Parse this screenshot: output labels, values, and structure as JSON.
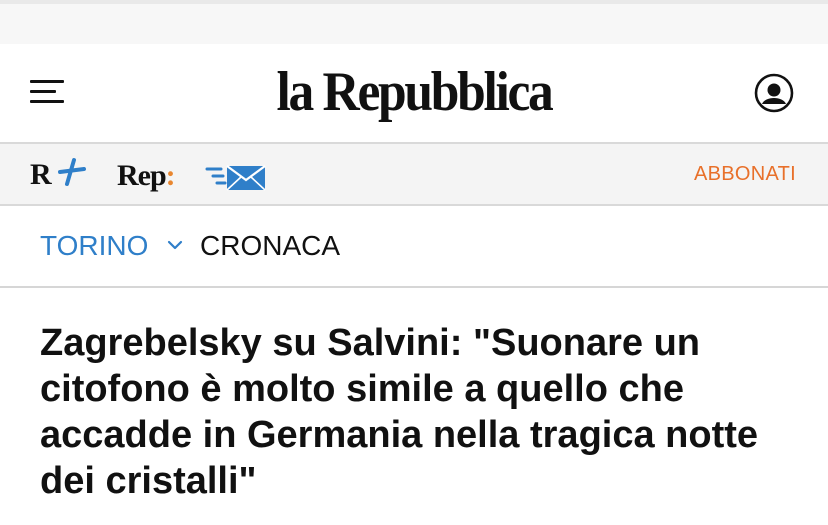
{
  "header": {
    "logo_text": "la Repubblica"
  },
  "subnav": {
    "rplus_label": "R+",
    "rep_label": "Rep",
    "rep_colon": ":",
    "subscribe_label": "ABBONATI"
  },
  "breadcrumb": {
    "city": "TORINO",
    "section": "CRONACA"
  },
  "article": {
    "headline": "Zagrebelsky su Salvini: \"Suonare un citofono è molto simile a quello che accadde in Germania nella tragica notte dei cristalli\""
  },
  "icons": {
    "menu": "hamburger-menu-icon",
    "user": "user-account-icon",
    "newsletter": "envelope-icon",
    "chevron": "chevron-down-icon"
  },
  "colors": {
    "accent_orange": "#e8702a",
    "link_blue": "#2f7fc9",
    "text_dark": "#111111",
    "subnav_bg": "#f4f4f4"
  }
}
